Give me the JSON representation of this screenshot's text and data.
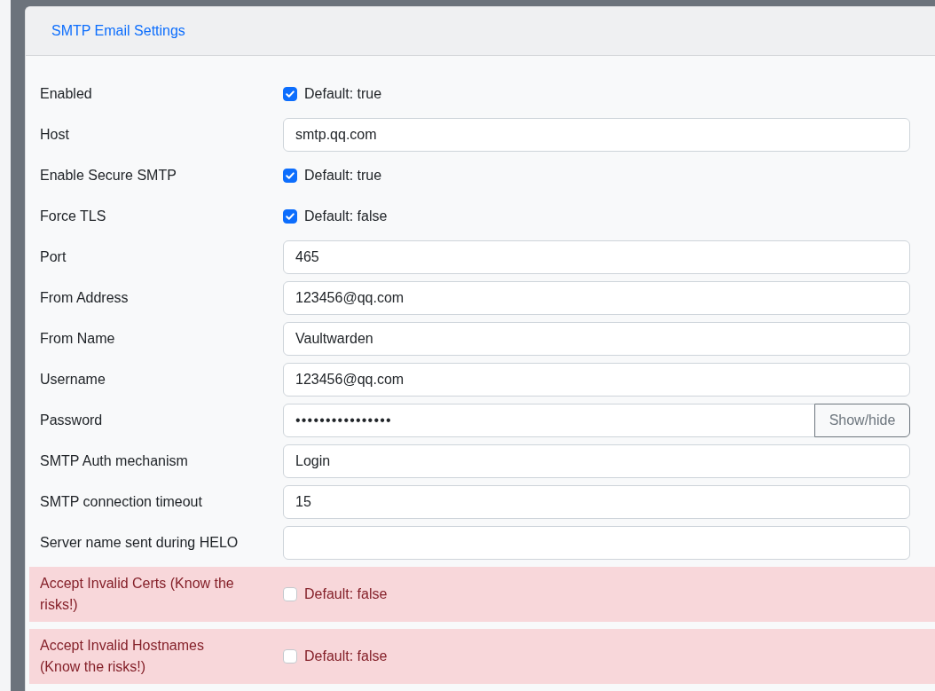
{
  "card": {
    "title": "SMTP Email Settings"
  },
  "rows": [
    {
      "kind": "checkbox",
      "label": "Enabled",
      "checked": true,
      "note": "Default: true",
      "warning": false
    },
    {
      "kind": "text",
      "label": "Host",
      "value": "smtp.qq.com",
      "warning": false
    },
    {
      "kind": "checkbox",
      "label": "Enable Secure SMTP",
      "checked": true,
      "note": "Default: true",
      "warning": false
    },
    {
      "kind": "checkbox",
      "label": "Force TLS",
      "checked": true,
      "note": "Default: false",
      "warning": false
    },
    {
      "kind": "text",
      "label": "Port",
      "value": "465",
      "warning": false
    },
    {
      "kind": "text",
      "label": "From Address",
      "value": "123456@qq.com",
      "warning": false
    },
    {
      "kind": "text",
      "label": "From Name",
      "value": "Vaultwarden",
      "warning": false
    },
    {
      "kind": "text",
      "label": "Username",
      "value": "123456@qq.com",
      "warning": false
    },
    {
      "kind": "password",
      "label": "Password",
      "value": "••••••••••••••••",
      "button": "Show/hide",
      "warning": false
    },
    {
      "kind": "text",
      "label": "SMTP Auth mechanism",
      "value": "Login",
      "warning": false
    },
    {
      "kind": "text",
      "label": "SMTP connection timeout",
      "value": "15",
      "warning": false
    },
    {
      "kind": "text",
      "label": "Server name sent during HELO",
      "warning": false
    },
    {
      "kind": "checkbox",
      "label": "Accept Invalid Certs (Know the risks!)",
      "checked": false,
      "note": "Default: false",
      "warning": true
    },
    {
      "kind": "checkbox",
      "label": "Accept Invalid Hostnames (Know the risks!)",
      "checked": false,
      "note": "Default: false",
      "warning": true
    }
  ]
}
